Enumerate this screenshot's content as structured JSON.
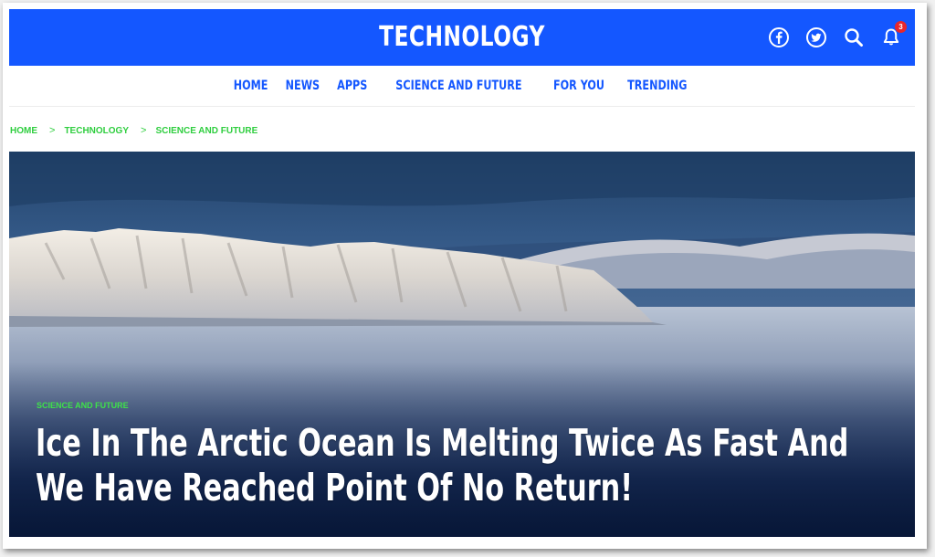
{
  "header": {
    "site_title": "TECHNOLOGY",
    "icons": [
      "facebook-icon",
      "twitter-icon",
      "search-icon",
      "bell-icon"
    ],
    "notification_count": "3",
    "brand_color": "#1457ff",
    "badge_color": "#e8272c"
  },
  "nav": {
    "items": [
      {
        "label": "HOME"
      },
      {
        "label": "NEWS"
      },
      {
        "label": "APPS"
      },
      {
        "label": "SCIENCE AND FUTURE"
      },
      {
        "label": "FOR YOU"
      },
      {
        "label": "TRENDING"
      }
    ]
  },
  "breadcrumb": {
    "items": [
      {
        "label": "HOME"
      },
      {
        "label": "TECHNOLOGY"
      },
      {
        "label": "SCIENCE AND FUTURE"
      }
    ],
    "separator": ">",
    "color": "#2fce3f"
  },
  "hero": {
    "category": "SCIENCE AND FUTURE",
    "title": "Ice In The Arctic Ocean Is Melting Twice As Fast And We Have Reached Point Of No Return!"
  }
}
